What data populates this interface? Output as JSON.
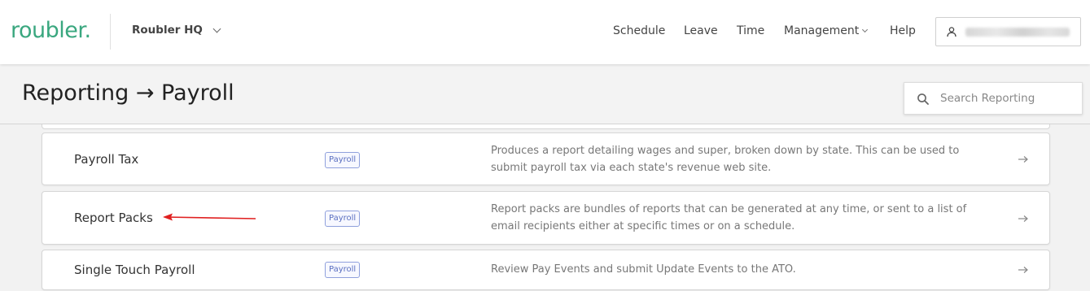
{
  "app": {
    "logo": "roubler.",
    "brand_color": "#3aa77f",
    "org_selector": "Roubler HQ"
  },
  "nav": {
    "items": [
      "Schedule",
      "Leave",
      "Time",
      "Management",
      "Help"
    ]
  },
  "page": {
    "title": "Reporting → Payroll"
  },
  "search": {
    "placeholder": "Search Reporting"
  },
  "reports": [
    {
      "name": "Payroll Tax",
      "tag": "Payroll",
      "description": "Produces a report detailing wages and super, broken down by state. This can be used to submit payroll tax via each state's revenue web site."
    },
    {
      "name": "Report Packs",
      "tag": "Payroll",
      "description": "Report packs are bundles of reports that can be generated at any time, or sent to a list of email recipients either at specific times or on a schedule."
    },
    {
      "name": "Single Touch Payroll",
      "tag": "Payroll",
      "description": "Review Pay Events and submit Update Events to the ATO."
    }
  ],
  "icons": {
    "user": "user-icon",
    "search": "search-icon",
    "row_arrow": "arrow-right-icon",
    "annotation": "red-arrow-annotation"
  },
  "colors": {
    "tag_border": "#8fa0dc",
    "tag_text": "#5a6fc0",
    "annotation": "#e02020"
  }
}
